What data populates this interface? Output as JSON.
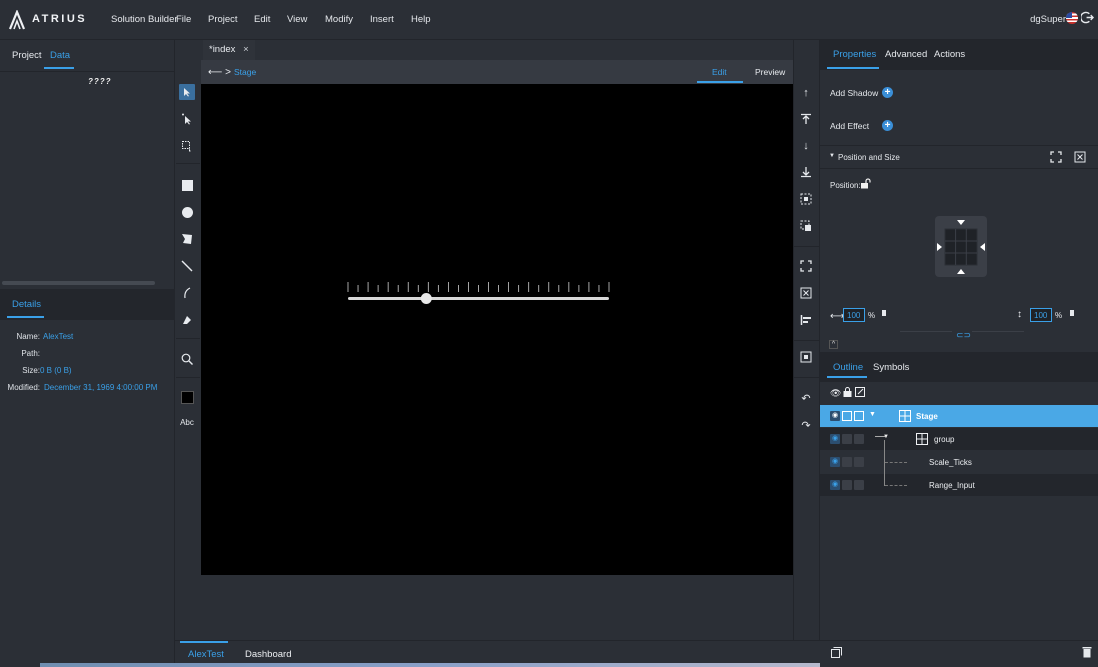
{
  "app": {
    "brand": "ATRIUS",
    "product": "Solution Builder",
    "menu": [
      "File",
      "Project",
      "Edit",
      "View",
      "Modify",
      "Insert",
      "Help"
    ],
    "user": "dgSuper"
  },
  "left_panel": {
    "tabs": [
      "Project",
      "Data"
    ],
    "active_tab": "Data",
    "data_logo": "????",
    "details_tab": "Details",
    "details": {
      "name_label": "Name:",
      "name_value": "AlexTest",
      "path_label": "Path:",
      "path_value": "",
      "size_label": "Size:",
      "size_value": "0 B (0 B)",
      "modified_label": "Modified:",
      "modified_value": "December 31, 1969 4:00:00 PM"
    }
  },
  "tools": {
    "text_tool": "Abc"
  },
  "editor": {
    "doc_tab": "*index",
    "doc_tab_close": "×",
    "back_icon": "⟵ >",
    "breadcrumb": "Stage",
    "mode_edit": "Edit",
    "mode_preview": "Preview",
    "slider": {
      "value": 0.3,
      "tick_count": 27
    }
  },
  "right_panel": {
    "tabs": [
      "Properties",
      "Advanced",
      "Actions"
    ],
    "active_tab": "Properties",
    "add_shadow": "Add Shadow",
    "add_effect": "Add Effect",
    "section_title": "Position and Size",
    "position_label": "Position:",
    "width_value": "100",
    "height_value": "100",
    "percent": "%",
    "outline_tabs": [
      "Outline",
      "Symbols"
    ],
    "active_outline_tab": "Outline",
    "outline": [
      {
        "label": "Stage",
        "selected": true
      },
      {
        "label": "group",
        "selected": false
      },
      {
        "label": "Scale_Ticks",
        "selected": false
      },
      {
        "label": "Range_Input",
        "selected": false
      }
    ]
  },
  "bottom": {
    "tabs": [
      "AlexTest",
      "Dashboard"
    ],
    "active_tab": "AlexTest"
  },
  "colors": {
    "accent": "#3aa0e8",
    "selected_row": "#4aa8e6",
    "panel_bg": "#2b2f36",
    "stage_bg": "#000000"
  }
}
